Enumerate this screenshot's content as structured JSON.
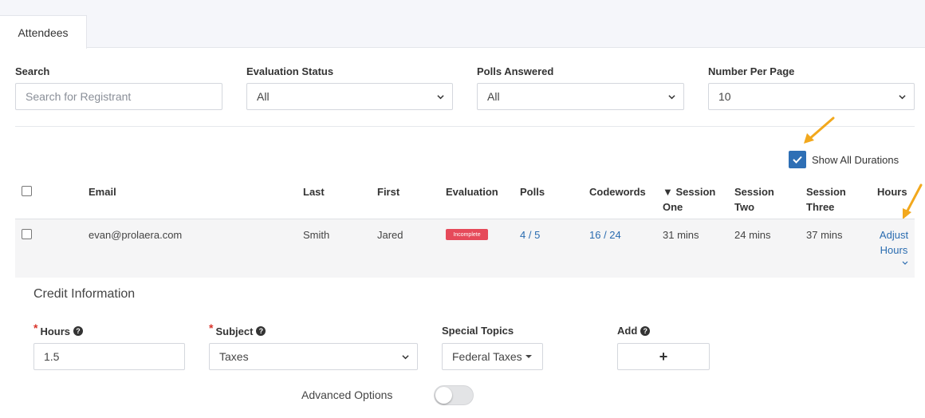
{
  "tabs": {
    "attendees": "Attendees"
  },
  "filters": {
    "search_label": "Search",
    "search_placeholder": "Search for Registrant",
    "evaluation_label": "Evaluation Status",
    "evaluation_value": "All",
    "polls_label": "Polls Answered",
    "polls_value": "All",
    "per_page_label": "Number Per Page",
    "per_page_value": "10"
  },
  "show_all_durations": {
    "label": "Show All Durations",
    "checked": true
  },
  "table": {
    "headers": {
      "email": "Email",
      "last": "Last",
      "first": "First",
      "evaluation": "Evaluation",
      "polls": "Polls",
      "codewords": "Codewords",
      "session_one_a": "▼ Session",
      "session_one_b": "One",
      "session_two_a": "Session",
      "session_two_b": "Two",
      "session_three_a": "Session",
      "session_three_b": "Three",
      "hours": "Hours"
    },
    "row": {
      "email": "evan@prolaera.com",
      "last": "Smith",
      "first": "Jared",
      "evaluation": "Incomplete",
      "polls": "4 / 5",
      "codewords": "16 / 24",
      "session_one": "31 mins",
      "session_two": "24 mins",
      "session_three": "37 mins",
      "adjust_a": "Adjust",
      "adjust_b": "Hours"
    }
  },
  "credit": {
    "title": "Credit Information",
    "hours_label": "Hours",
    "hours_value": "1.5",
    "subject_label": "Subject",
    "subject_value": "Taxes",
    "special_label": "Special Topics",
    "special_value": "Federal Taxes",
    "add_label": "Add",
    "add_symbol": "+",
    "advanced_label": "Advanced Options",
    "advanced_on": false
  },
  "colors": {
    "accent": "#2e6fb5",
    "link": "#2a6cb0",
    "badge": "#e64a5a",
    "arrow": "#f2a81d"
  }
}
